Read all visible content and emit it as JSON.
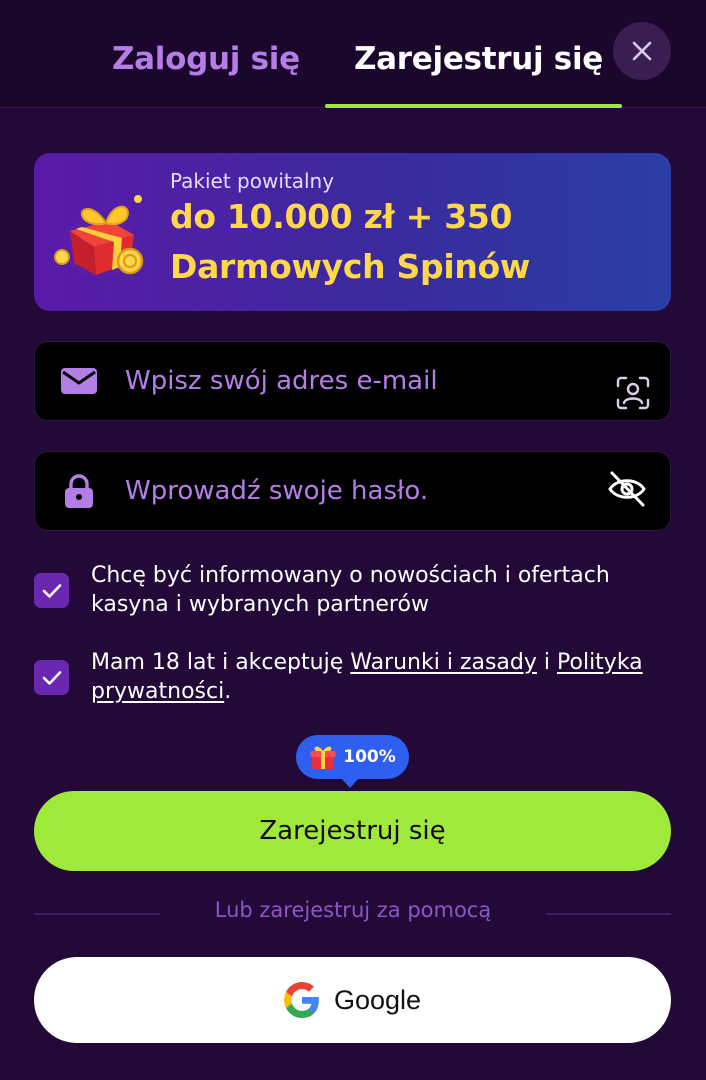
{
  "tabs": {
    "login_label": "Zaloguj się",
    "register_label": "Zarejestruj się",
    "active": "register"
  },
  "promo": {
    "subtitle": "Pakiet powitalny",
    "line1": "do 10.000 zł + 350",
    "line2": "Darmowych Spinów"
  },
  "form": {
    "email_placeholder": "Wpisz swój adres e-mail",
    "password_placeholder": "Wprowadź swoje hasło.",
    "email_value": "",
    "password_value": ""
  },
  "consents": {
    "newsletter_text": "Chcę być informowany o nowościach i ofertach kasyna i wybranych partnerów",
    "newsletter_checked": true,
    "age_prefix": "Mam 18 lat i akceptuję ",
    "terms_link": "Warunki i zasady",
    "age_middle": " i ",
    "privacy_link": "Polityka prywatności",
    "age_suffix": ".",
    "age_checked": true
  },
  "bonus_badge": {
    "value": "100%"
  },
  "submit_label": "Zarejestruj się",
  "alt_signup_text": "Lub zarejestruj za pomocą",
  "google_label": "Google",
  "icons": {
    "close": "close-icon",
    "gift": "gift-icon",
    "email": "mail-icon",
    "face_id": "face-scan-icon",
    "lock": "lock-icon",
    "eye_off": "eye-off-icon",
    "check": "check-icon",
    "google": "google-logo-icon"
  },
  "colors": {
    "background": "#220937",
    "header": "#1b072c",
    "accent_green": "#9ee93a",
    "tab_inactive": "#b47ee6",
    "checkbox": "#6a28b0",
    "promo_gold": "#ffd84a",
    "badge_blue": "#2f5ff0"
  }
}
